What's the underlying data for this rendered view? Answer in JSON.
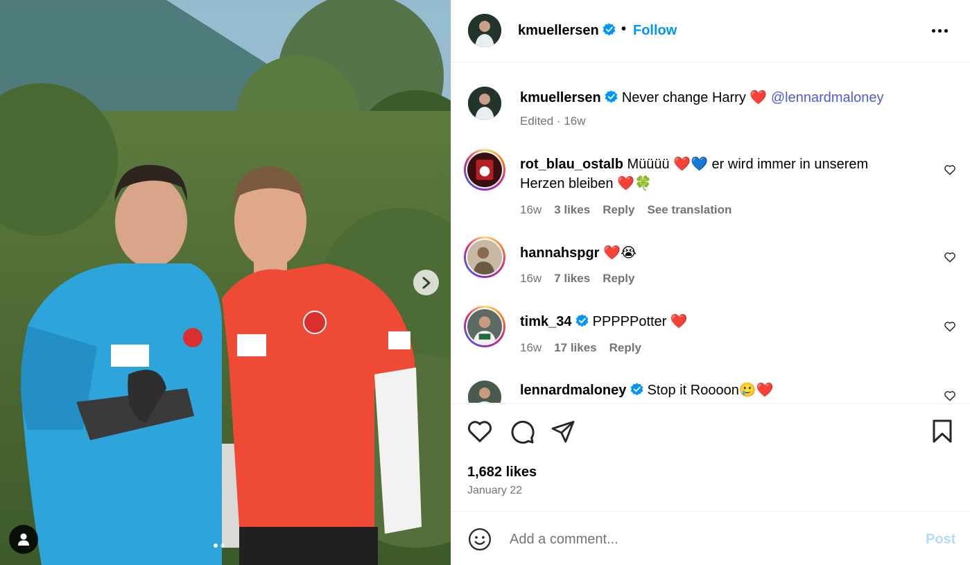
{
  "post": {
    "username": "kmuellersen",
    "verified": true,
    "follow_label": "Follow",
    "separator": "•",
    "more_icon": "more-horizontal-icon"
  },
  "caption": {
    "username": "kmuellersen",
    "text": "Never change Harry",
    "emoji": "❤️",
    "mention": "@lennardmaloney",
    "meta": "Edited · 16w"
  },
  "comments": [
    {
      "username": "rot_blau_ostalb",
      "verified": false,
      "text_line1": "Müüüü ❤️💙 er wird immer in unserem",
      "text_line2": "Herzen bleiben ❤️🍀",
      "age": "16w",
      "likes": "3 likes",
      "reply": "Reply",
      "translate": "See translation"
    },
    {
      "username": "hannahspgr",
      "verified": false,
      "text_line1": "❤️😭",
      "age": "16w",
      "likes": "7 likes",
      "reply": "Reply"
    },
    {
      "username": "timk_34",
      "verified": true,
      "text_line1": "PPPPPotter ❤️",
      "age": "16w",
      "likes": "17 likes",
      "reply": "Reply"
    },
    {
      "username": "lennardmaloney",
      "verified": true,
      "text_line1": "Stop it Roooon🥲❤️"
    }
  ],
  "stats": {
    "likes": "1,682 likes",
    "date": "January 22"
  },
  "composer": {
    "placeholder": "Add a comment...",
    "post_label": "Post"
  },
  "carousel": {
    "slide_count": 2,
    "active_index": 0
  },
  "colors": {
    "accent": "#0095f6",
    "mention": "#4f5bd5",
    "muted": "#737373",
    "post_disabled": "#b3dbff"
  }
}
